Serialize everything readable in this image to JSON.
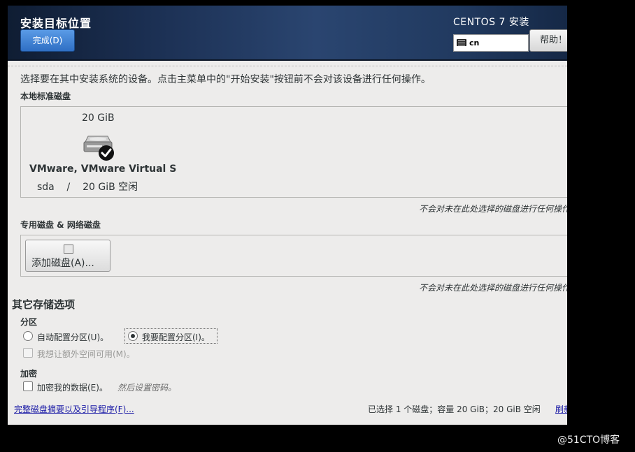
{
  "header": {
    "title": "安装目标位置",
    "done_button": "完成(D)",
    "product": "CENTOS 7 安装",
    "keyboard_layout": "cn",
    "help_button": "帮助！"
  },
  "description": "选择要在其中安装系统的设备。点击主菜单中的\"开始安装\"按钮前不会对该设备进行任何操作。",
  "local_disks": {
    "label": "本地标准磁盘",
    "disks": [
      {
        "size": "20 GiB",
        "name": "VMware, VMware Virtual S",
        "info": "sda    /    20 GiB 空闲",
        "selected": true
      }
    ],
    "note": "不会对未在此处选择的磁盘进行任何操作"
  },
  "specialized_disks": {
    "label": "专用磁盘 & 网络磁盘",
    "add_button": "添加磁盘(A)...",
    "note": "不会对未在此处选择的磁盘进行任何操作"
  },
  "other_storage": {
    "title": "其它存储选项",
    "partition_label": "分区",
    "auto_partition": "自动配置分区(U)。",
    "manual_partition": "我要配置分区(I)。",
    "selected_partition": "manual",
    "extra_space": "我想让额外空间可用(M)。",
    "encryption_label": "加密",
    "encrypt_data": "加密我的数据(E)。",
    "encrypt_hint": "然后设置密码。"
  },
  "footer": {
    "summary_link": "完整磁盘摘要以及引导程序(F)...",
    "summary_text": "已选择 1 个磁盘；容量 20 GiB；20 GiB 空闲",
    "refresh_link": "刷新"
  },
  "watermark": "@51CTO博客",
  "colors": {
    "header_bg": "#213a60",
    "done_button": "#3b7fd4",
    "window_bg": "#edeceb",
    "link": "#1a1aa6"
  }
}
